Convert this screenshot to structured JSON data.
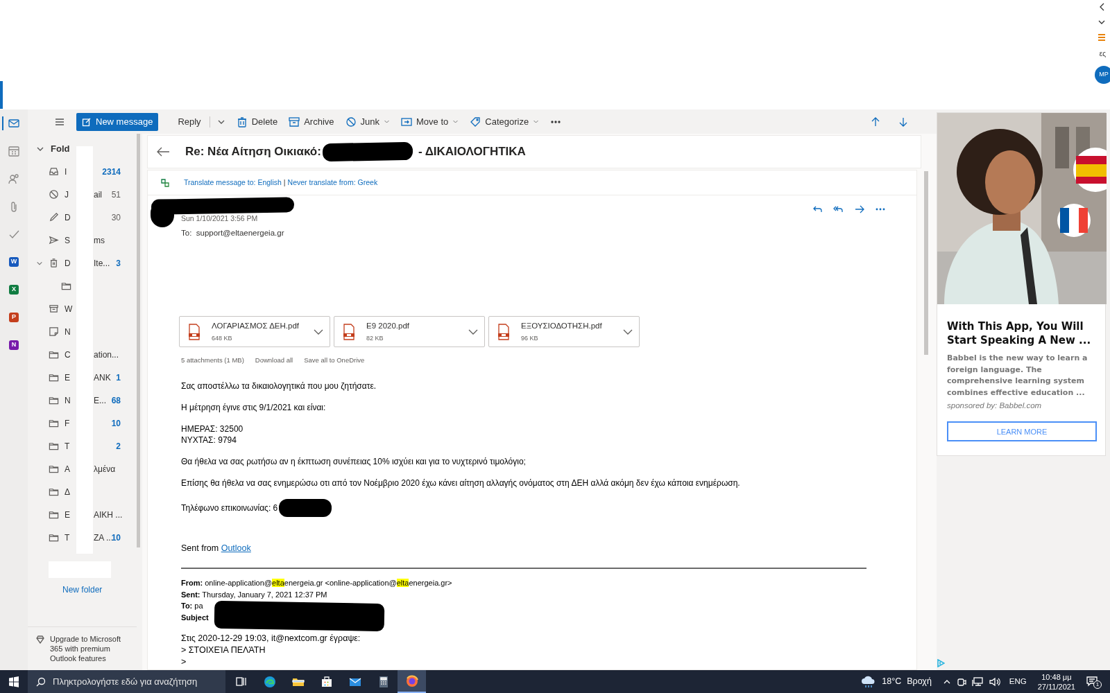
{
  "browser_edge": {
    "text": "ες",
    "avatar": "MP"
  },
  "rail": [
    {
      "kind": "mail",
      "selected": true
    },
    {
      "kind": "calendar",
      "selected": false
    },
    {
      "kind": "people",
      "selected": false
    },
    {
      "kind": "files",
      "selected": false
    },
    {
      "kind": "todo",
      "selected": false
    },
    {
      "kind": "app",
      "letter": "W",
      "color": "#185abd"
    },
    {
      "kind": "app",
      "letter": "X",
      "color": "#107c41"
    },
    {
      "kind": "app",
      "letter": "P",
      "color": "#c43e1c"
    },
    {
      "kind": "app",
      "letter": "N",
      "color": "#7719aa"
    }
  ],
  "toolbar": {
    "new_message": "New message",
    "actions": [
      {
        "label": "Reply",
        "kind": "split"
      },
      {
        "label": "Delete",
        "kind": "delete",
        "dropdown": false
      },
      {
        "label": "Archive",
        "kind": "archive",
        "dropdown": false
      },
      {
        "label": "Junk",
        "kind": "junk",
        "dropdown": true
      },
      {
        "label": "Move to",
        "kind": "move",
        "dropdown": true
      },
      {
        "label": "Categorize",
        "kind": "categorize",
        "dropdown": true
      }
    ]
  },
  "folders": {
    "header": "Fold",
    "expanded": true,
    "items": [
      {
        "kind": "inbox",
        "start": "I",
        "count": "2314",
        "unread": true
      },
      {
        "kind": "junk",
        "start": "J",
        "end": "ail",
        "count": "51",
        "unread": false
      },
      {
        "kind": "drafts",
        "start": "D",
        "count": "30",
        "unread": false
      },
      {
        "kind": "sent",
        "start": "S",
        "end": "ms"
      },
      {
        "kind": "deleted",
        "start": "D",
        "end": "Ite...",
        "count": "3",
        "unread": true,
        "expanded": true,
        "children": [
          {
            "kind": "folder"
          }
        ]
      },
      {
        "kind": "archive",
        "start": "W"
      },
      {
        "kind": "notes",
        "start": "N"
      },
      {
        "kind": "folder",
        "start": "C",
        "end": "ation..."
      },
      {
        "kind": "folder",
        "start": "E",
        "end": "ANK",
        "count": "1",
        "unread": true
      },
      {
        "kind": "folder",
        "start": "N",
        "end": "E...",
        "count": "68",
        "unread": true
      },
      {
        "kind": "folder",
        "start": "F",
        "count": "10",
        "unread": true
      },
      {
        "kind": "folder",
        "start": "T",
        "count": "2",
        "unread": true
      },
      {
        "kind": "folder",
        "start": "Α",
        "end": "λμένα"
      },
      {
        "kind": "folder",
        "start": "Δ"
      },
      {
        "kind": "folder",
        "start": "E",
        "end": "ΑΙΚΗ ..."
      },
      {
        "kind": "folder",
        "start": "T",
        "end": "ΖΑ ...",
        "count": "10",
        "unread": true
      }
    ],
    "new_folder": "New folder",
    "upgrade": "Upgrade to Microsoft 365 with premium Outlook features"
  },
  "message": {
    "subject": "Re: Νέα Αίτηση Οικιακό:",
    "subject_end": "- ΔΙΚΑΙΟΛΟΓΗΤΙΚΑ",
    "translate": {
      "to": "Translate message to: English",
      "separator": "|",
      "never": "Never translate from: Greek"
    },
    "date": "Sun 1/10/2021 3:56 PM",
    "to": "To:  support@eltaenergeia.gr",
    "attachments": [
      {
        "name": "ΛΟΓΑΡΙΑΣΜΟΣ ΔΕΗ.pdf",
        "size": "648 KB"
      },
      {
        "name": "E9 2020.pdf",
        "size": "82 KB"
      },
      {
        "name": "ΕΞΟΥΣΙΟΔΟΤΗΣΗ.pdf",
        "size": "96 KB"
      }
    ],
    "attachments_summary": "5 attachments (1 MB)",
    "download_all": "Download all",
    "save_all": "Save all to OneDrive",
    "body": [
      [
        "Σας αποστέλλω τα δικαιολογητικά που μου ζητήσατε."
      ],
      [
        "Η μέτρηση έγινε στις 9/1/2021 και είναι:"
      ],
      [
        "ΗΜΕΡΑΣ: 32500",
        "ΝΥΧΤΑΣ: 9794"
      ],
      [
        "Θα ήθελα να σας ρωτήσω αν η έκπτωση συνέπειας 10% ισχύει και για το νυχτερινό τιμολόγιο;"
      ],
      [
        "Επίσης θα ήθελα να σας ενημερώσω οτι από τον Νοέμβριο 2020 έχω κάνει αίτηση αλλαγής ονόματος στη ΔΕΗ αλλά ακόμη δεν έχω κάποια ενημέρωση."
      ]
    ],
    "phone": "Τηλέφωνο επικοινωνίας: 6",
    "signature": "Sent from ",
    "signature_link": "Outlook",
    "quoted_header": [
      {
        "label": "From:",
        "parts": [
          {
            "text": " online-application@",
            "highlight": false
          },
          {
            "text": "elta",
            "highlight": true
          },
          {
            "text": "energeia.gr <online-application@",
            "highlight": false
          },
          {
            "text": "elta",
            "highlight": true
          },
          {
            "text": "energeia.gr>",
            "highlight": false
          }
        ]
      },
      {
        "label": "Sent:",
        "parts": [
          {
            "text": " Thursday, January 7, 2021 12:37 PM",
            "highlight": false
          }
        ]
      },
      {
        "label": "To:",
        "parts": [
          {
            "text": " pa",
            "highlight": false
          }
        ]
      },
      {
        "label": "Subject"
      }
    ],
    "quoted_body": [
      "Στις 2020-12-29 19:03, it@nextcom.gr έγραψε:",
      "> ΣΤΟΙΧΕΊΑ ΠΕΛΆΤΗ",
      ">"
    ]
  },
  "ad": {
    "kind": "picture",
    "title": "With This App, You Will Start Speaking A New ...",
    "text": "Babbel is the new way to learn a foreign language. The comprehensive learning system combines effective education ...",
    "sponsor": "sponsored by: Babbel.com",
    "button": "LEARN MORE"
  },
  "taskbar": {
    "search": "Πληκτρολογήστε εδώ για αναζήτηση",
    "apps": [
      {
        "kind": "taskview",
        "selected": false
      },
      {
        "kind": "edge",
        "selected": false
      },
      {
        "kind": "explorer",
        "selected": false
      },
      {
        "kind": "store",
        "selected": false
      },
      {
        "kind": "mail",
        "selected": false
      },
      {
        "kind": "calculator",
        "selected": false
      },
      {
        "kind": "firefox",
        "selected": true
      }
    ],
    "temperature": "18°C",
    "weather": "Βροχή",
    "language": "ENG",
    "time": "10:48 μμ",
    "date": "27/11/2021",
    "notifications": "1"
  }
}
